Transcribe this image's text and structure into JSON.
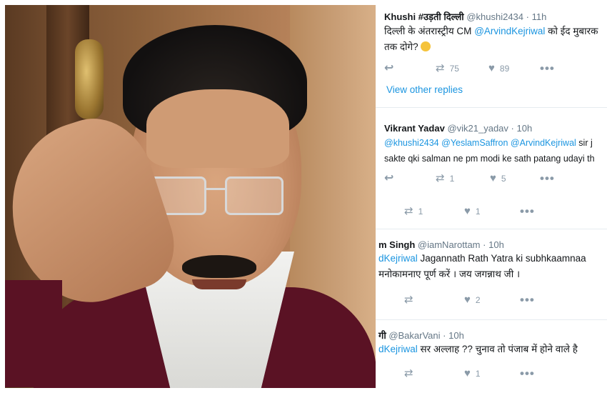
{
  "tweets": [
    {
      "name": "Khushi #उड़ती दिल्ली",
      "handle": "@khushi2434",
      "dot": "·",
      "time": "11h",
      "line1_pre": "दिल्ली के अंतरास्ट्रीय CM ",
      "line1_mention": "@ArvindKejriwal",
      "line1_post": " को ईद मुबारक",
      "line2": "तक दोगे?",
      "emoji": "confused-face",
      "retweets": "75",
      "likes": "89"
    },
    {
      "name": "Vikrant Yadav",
      "handle": "@vik21_yadav",
      "dot": "·",
      "time": "10h",
      "mention1": "@khushi2434",
      "mention2": "@YeslamSaffron",
      "mention3": "@ArvindKejriwal",
      "line1_post": " sir j",
      "line2": "sakte qki salman ne pm modi ke sath patang udayi th",
      "retweets": "1",
      "likes": "5"
    },
    {
      "name": "m Singh",
      "handle": "@iamNarottam",
      "dot": "·",
      "time": "10h",
      "line1_mention": "dKejriwal",
      "line1_post": " Jagannath Rath Yatra ki subhkaamnaa",
      "line2": "मनोकामनाए पूर्ण करें । जय जगन्नाथ जी ।",
      "likes": "2"
    },
    {
      "name": "गी",
      "handle": "@BakarVani",
      "dot": "·",
      "time": "10h",
      "line1_mention": "dKejriwal",
      "line1_post": " सर अल्लाह ?? चुनाव तो पंजाब में होने वाले है",
      "likes": "1"
    }
  ],
  "view_other_replies": "View other replies",
  "thread_actions": {
    "retweets": "1",
    "likes": "1"
  },
  "icons": [
    "reply-icon",
    "retweet-icon",
    "like-icon",
    "more-icon"
  ],
  "colors": {
    "link": "#1b95e0",
    "muted": "#657786",
    "text": "#14171a",
    "icon": "#8a9aa8",
    "divider": "#e6ecf0"
  }
}
